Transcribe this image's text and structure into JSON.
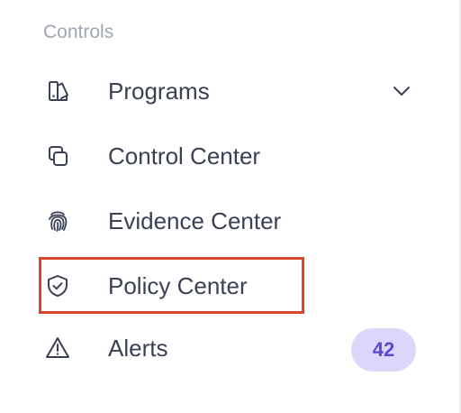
{
  "section": {
    "heading": "Controls"
  },
  "nav": {
    "items": [
      {
        "label": "Programs",
        "icon": "programs-icon",
        "expandable": true
      },
      {
        "label": "Control Center",
        "icon": "copy-squares-icon"
      },
      {
        "label": "Evidence Center",
        "icon": "fingerprint-icon"
      },
      {
        "label": "Policy Center",
        "icon": "shield-check-icon",
        "highlighted": true
      },
      {
        "label": "Alerts",
        "icon": "warning-triangle-icon",
        "badge": "42"
      }
    ]
  },
  "colors": {
    "text": "#3b4154",
    "heading": "#a0a7b4",
    "highlight_border": "#d9462b",
    "badge_bg": "#dcd6fb",
    "badge_text": "#6145d6"
  }
}
